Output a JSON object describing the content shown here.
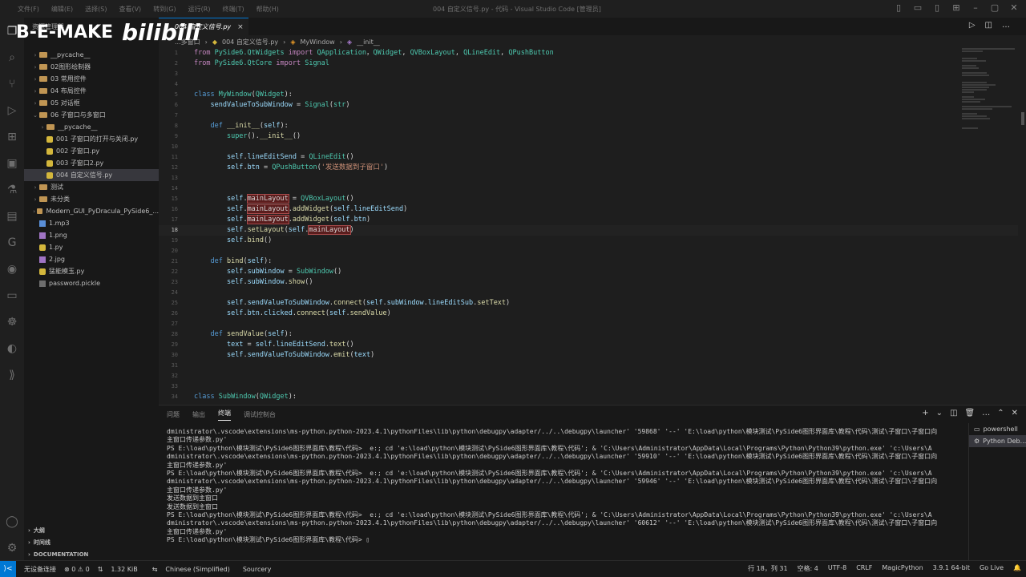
{
  "titlebar": {
    "menu": [
      "文件(F)",
      "编辑(E)",
      "选择(S)",
      "查看(V)",
      "转到(G)",
      "运行(R)",
      "终端(T)",
      "帮助(H)"
    ],
    "title": "004 自定义信号.py - 代码 - Visual Studio Code [管理员]"
  },
  "watermark": {
    "text": "B-E-MAKE",
    "logo": "bilibili"
  },
  "sidebar": {
    "header": "资源管理器",
    "items": [
      {
        "label": "__pycache__",
        "type": "folder",
        "indent": 1
      },
      {
        "label": "02图形绘制器",
        "type": "folder",
        "indent": 1
      },
      {
        "label": "03 常用控件",
        "type": "folder",
        "indent": 1
      },
      {
        "label": "04 布局控件",
        "type": "folder",
        "indent": 1
      },
      {
        "label": "05 对话框",
        "type": "folder",
        "indent": 1
      },
      {
        "label": "06 子窗口与多窗口",
        "type": "folder-open",
        "indent": 1
      },
      {
        "label": "__pycache__",
        "type": "folder",
        "indent": 2
      },
      {
        "label": "001 子窗口的打开与关闭.py",
        "type": "py",
        "indent": 2
      },
      {
        "label": "002 子窗口.py",
        "type": "py",
        "indent": 2
      },
      {
        "label": "003 子窗口2.py",
        "type": "py",
        "indent": 2
      },
      {
        "label": "004 自定义信号.py",
        "type": "py",
        "indent": 2,
        "selected": true
      },
      {
        "label": "测试",
        "type": "folder",
        "indent": 1
      },
      {
        "label": "未分类",
        "type": "folder",
        "indent": 1
      },
      {
        "label": "Modern_GUI_PyDracula_PySide6_...",
        "type": "folder",
        "indent": 1
      },
      {
        "label": "1.mp3",
        "type": "mp3",
        "indent": 1
      },
      {
        "label": "1.png",
        "type": "img",
        "indent": 1
      },
      {
        "label": "1.py",
        "type": "py",
        "indent": 1
      },
      {
        "label": "2.jpg",
        "type": "img",
        "indent": 1
      },
      {
        "label": "猛能模玉.py",
        "type": "py",
        "indent": 1
      },
      {
        "label": "password.pickle",
        "type": "plain",
        "indent": 1
      }
    ],
    "sections": [
      "大纲",
      "时间线",
      "DOCUMENTATION"
    ]
  },
  "tab": {
    "label": "004 自定义信号.py",
    "close": "×"
  },
  "breadcrumb": [
    "...多窗口",
    "004 自定义信号.py",
    "MyWindow",
    "__init__"
  ],
  "code": {
    "line_numbers": [
      "1",
      "2",
      "3",
      "4",
      "5",
      "6",
      "7",
      "8",
      "9",
      "10",
      "11",
      "12",
      "13",
      "14",
      "15",
      "16",
      "17",
      "18",
      "19",
      "20",
      "21",
      "22",
      "23",
      "24",
      "25",
      "26",
      "27",
      "28",
      "29",
      "30",
      "31",
      "32",
      "33",
      "34"
    ],
    "current_line": "18",
    "lines": [
      [
        [
          "kw2",
          "from "
        ],
        [
          "mod",
          "PySide6.QtWidgets"
        ],
        [
          "kw2",
          " import "
        ],
        [
          "cls",
          "QApplication"
        ],
        [
          "",
          "，"
        ],
        [
          "cls",
          "QWidget"
        ],
        [
          "",
          ", "
        ],
        [
          "cls",
          "QVBoxLayout"
        ],
        [
          "",
          ", "
        ],
        [
          "cls",
          "QLineEdit"
        ],
        [
          "",
          ", "
        ],
        [
          "cls",
          "QPushButton"
        ]
      ],
      [
        [
          "kw2",
          "from "
        ],
        [
          "mod",
          "PySide6.QtCore"
        ],
        [
          "kw2",
          " import "
        ],
        [
          "cls",
          "Signal"
        ]
      ],
      [],
      [],
      [
        [
          "kw",
          "class "
        ],
        [
          "cls",
          "MyWindow"
        ],
        [
          "",
          "("
        ],
        [
          "cls",
          "QWidget"
        ],
        [
          "",
          "):"
        ]
      ],
      [
        [
          "",
          "    "
        ],
        [
          "slf",
          "sendValueToSubWindow"
        ],
        [
          "",
          " = "
        ],
        [
          "cls",
          "Signal"
        ],
        [
          "",
          "("
        ],
        [
          "cls",
          "str"
        ],
        [
          "",
          ")"
        ]
      ],
      [],
      [
        [
          "",
          "    "
        ],
        [
          "kw",
          "def "
        ],
        [
          "fn",
          "__init__"
        ],
        [
          "",
          "("
        ],
        [
          "slf",
          "self"
        ],
        [
          "",
          "):"
        ]
      ],
      [
        [
          "",
          "        "
        ],
        [
          "cls",
          "super"
        ],
        [
          "",
          "()."
        ],
        [
          "fn",
          "__init__"
        ],
        [
          "",
          "()"
        ]
      ],
      [],
      [
        [
          "",
          "        "
        ],
        [
          "slf",
          "self"
        ],
        [
          "",
          "."
        ],
        [
          "slf",
          "lineEditSend"
        ],
        [
          "",
          " = "
        ],
        [
          "cls",
          "QLineEdit"
        ],
        [
          "",
          "()"
        ]
      ],
      [
        [
          "",
          "        "
        ],
        [
          "slf",
          "self"
        ],
        [
          "",
          "."
        ],
        [
          "slf",
          "btn"
        ],
        [
          "",
          " = "
        ],
        [
          "cls",
          "QPushButton"
        ],
        [
          "",
          "("
        ],
        [
          "str",
          "'发送数据到子窗口'"
        ],
        [
          "",
          ")"
        ]
      ],
      [],
      [],
      [
        [
          "",
          "        "
        ],
        [
          "slf",
          "self"
        ],
        [
          "",
          "."
        ],
        [
          "hl",
          "mainLayout"
        ],
        [
          "",
          " = "
        ],
        [
          "cls",
          "QVBoxLayout"
        ],
        [
          "",
          "()"
        ]
      ],
      [
        [
          "",
          "        "
        ],
        [
          "slf",
          "self"
        ],
        [
          "",
          "."
        ],
        [
          "hl",
          "mainLayout"
        ],
        [
          "",
          "."
        ],
        [
          "fn",
          "addWidget"
        ],
        [
          "",
          "("
        ],
        [
          "slf",
          "self"
        ],
        [
          "",
          "."
        ],
        [
          "slf",
          "lineEditSend"
        ],
        [
          "",
          ")"
        ]
      ],
      [
        [
          "",
          "        "
        ],
        [
          "slf",
          "self"
        ],
        [
          "",
          "."
        ],
        [
          "hl",
          "mainLayout"
        ],
        [
          "",
          "."
        ],
        [
          "fn",
          "addWidget"
        ],
        [
          "",
          "("
        ],
        [
          "slf",
          "self"
        ],
        [
          "",
          "."
        ],
        [
          "slf",
          "btn"
        ],
        [
          "",
          ")"
        ]
      ],
      [
        [
          "",
          "        "
        ],
        [
          "slf",
          "self"
        ],
        [
          "",
          "."
        ],
        [
          "fn",
          "setLayout"
        ],
        [
          "",
          "("
        ],
        [
          "slf",
          "self"
        ],
        [
          "",
          "."
        ],
        [
          "hl",
          "mainLayout"
        ],
        [
          "",
          ")"
        ]
      ],
      [
        [
          "",
          "        "
        ],
        [
          "slf",
          "self"
        ],
        [
          "",
          "."
        ],
        [
          "fn",
          "bind"
        ],
        [
          "",
          "()"
        ]
      ],
      [],
      [
        [
          "",
          "    "
        ],
        [
          "kw",
          "def "
        ],
        [
          "fn",
          "bind"
        ],
        [
          "",
          "("
        ],
        [
          "slf",
          "self"
        ],
        [
          "",
          "):"
        ]
      ],
      [
        [
          "",
          "        "
        ],
        [
          "slf",
          "self"
        ],
        [
          "",
          "."
        ],
        [
          "slf",
          "subWindow"
        ],
        [
          "",
          " = "
        ],
        [
          "cls",
          "SubWindow"
        ],
        [
          "",
          "()"
        ]
      ],
      [
        [
          "",
          "        "
        ],
        [
          "slf",
          "self"
        ],
        [
          "",
          "."
        ],
        [
          "slf",
          "subWindow"
        ],
        [
          "",
          "."
        ],
        [
          "fn",
          "show"
        ],
        [
          "",
          "()"
        ]
      ],
      [],
      [
        [
          "",
          "        "
        ],
        [
          "slf",
          "self"
        ],
        [
          "",
          "."
        ],
        [
          "slf",
          "sendValueToSubWindow"
        ],
        [
          "",
          "."
        ],
        [
          "fn",
          "connect"
        ],
        [
          "",
          "("
        ],
        [
          "slf",
          "self"
        ],
        [
          "",
          "."
        ],
        [
          "slf",
          "subWindow"
        ],
        [
          "",
          "."
        ],
        [
          "slf",
          "lineEditSub"
        ],
        [
          "",
          "."
        ],
        [
          "fn",
          "setText"
        ],
        [
          "",
          ")"
        ]
      ],
      [
        [
          "",
          "        "
        ],
        [
          "slf",
          "self"
        ],
        [
          "",
          "."
        ],
        [
          "slf",
          "btn"
        ],
        [
          "",
          "."
        ],
        [
          "slf",
          "clicked"
        ],
        [
          "",
          "."
        ],
        [
          "fn",
          "connect"
        ],
        [
          "",
          "("
        ],
        [
          "slf",
          "self"
        ],
        [
          "",
          "."
        ],
        [
          "fn",
          "sendValue"
        ],
        [
          "",
          ")"
        ]
      ],
      [],
      [
        [
          "",
          "    "
        ],
        [
          "kw",
          "def "
        ],
        [
          "fn",
          "sendValue"
        ],
        [
          "",
          "("
        ],
        [
          "slf",
          "self"
        ],
        [
          "",
          "):"
        ]
      ],
      [
        [
          "",
          "        "
        ],
        [
          "slf",
          "text"
        ],
        [
          "",
          " = "
        ],
        [
          "slf",
          "self"
        ],
        [
          "",
          "."
        ],
        [
          "slf",
          "lineEditSend"
        ],
        [
          "",
          "."
        ],
        [
          "fn",
          "text"
        ],
        [
          "",
          "()"
        ]
      ],
      [
        [
          "",
          "        "
        ],
        [
          "slf",
          "self"
        ],
        [
          "",
          "."
        ],
        [
          "slf",
          "sendValueToSubWindow"
        ],
        [
          "",
          "."
        ],
        [
          "fn",
          "emit"
        ],
        [
          "",
          "("
        ],
        [
          "slf",
          "text"
        ],
        [
          "",
          ")"
        ]
      ],
      [],
      [],
      [],
      [
        [
          "kw",
          "class "
        ],
        [
          "cls",
          "SubWindow"
        ],
        [
          "",
          "("
        ],
        [
          "cls",
          "QWidget"
        ],
        [
          "",
          "):"
        ]
      ]
    ]
  },
  "panel": {
    "tabs": [
      "问题",
      "输出",
      "终端",
      "调试控制台"
    ],
    "active_tab": "终端",
    "terminal_lines": [
      "dministrator\\.vscode\\extensions\\ms-python.python-2023.4.1\\pythonFiles\\lib\\python\\debugpy\\adapter/../..\\debugpy\\launcher' '59868' '--' 'E:\\load\\python\\模块测试\\PySide6图形界面库\\教程\\代码\\测试\\子窗口\\子窗口向",
      "主窗口传递参数.py'",
      "PS E:\\load\\python\\模块测试\\PySide6图形界面库\\教程\\代码>  e:; cd 'e:\\load\\python\\模块测试\\PySide6图形界面库\\教程\\代码'; & 'C:\\Users\\Administrator\\AppData\\Local\\Programs\\Python\\Python39\\python.exe' 'c:\\Users\\A",
      "dministrator\\.vscode\\extensions\\ms-python.python-2023.4.1\\pythonFiles\\lib\\python\\debugpy\\adapter/../..\\debugpy\\launcher' '59910' '--' 'E:\\load\\python\\模块测试\\PySide6图形界面库\\教程\\代码\\测试\\子窗口\\子窗口向",
      "主窗口传递参数.py'",
      "PS E:\\load\\python\\模块测试\\PySide6图形界面库\\教程\\代码>  e:; cd 'e:\\load\\python\\模块测试\\PySide6图形界面库\\教程\\代码'; & 'C:\\Users\\Administrator\\AppData\\Local\\Programs\\Python\\Python39\\python.exe' 'c:\\Users\\A",
      "dministrator\\.vscode\\extensions\\ms-python.python-2023.4.1\\pythonFiles\\lib\\python\\debugpy\\adapter/../..\\debugpy\\launcher' '59946' '--' 'E:\\load\\python\\模块测试\\PySide6图形界面库\\教程\\代码\\测试\\子窗口\\子窗口向",
      "主窗口传递参数.py'",
      "发送数据到主窗口",
      "发送数据到主窗口",
      "PS E:\\load\\python\\模块测试\\PySide6图形界面库\\教程\\代码>  e:; cd 'e:\\load\\python\\模块测试\\PySide6图形界面库\\教程\\代码'; & 'C:\\Users\\Administrator\\AppData\\Local\\Programs\\Python\\Python39\\python.exe' 'c:\\Users\\A",
      "dministrator\\.vscode\\extensions\\ms-python.python-2023.4.1\\pythonFiles\\lib\\python\\debugpy\\adapter/../..\\debugpy\\launcher' '60612' '--' 'E:\\load\\python\\模块测试\\PySide6图形界面库\\教程\\代码\\测试\\子窗口\\子窗口向",
      "主窗口传递参数.py'",
      "PS E:\\load\\python\\模块测试\\PySide6图形界面库\\教程\\代码> ▯"
    ],
    "terminals": [
      "powershell",
      "Python Deb..."
    ]
  },
  "statusbar": {
    "remote": "⟩<",
    "no_env": "无设备连接",
    "problems": "⊗ 0 ⚠ 0",
    "size": "1.32 KiB",
    "language_pack": "Chinese (Simplified)",
    "sourcery": "Sourcery",
    "position": "行 18，列 31",
    "spaces": "空格: 4",
    "encoding": "UTF-8",
    "eol": "CRLF",
    "language": "MagicPython",
    "python_version": "3.9.1 64-bit",
    "golive": "Go Live"
  }
}
